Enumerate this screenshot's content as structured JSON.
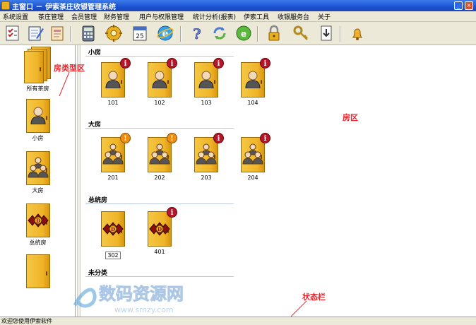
{
  "window": {
    "title": "主窗口 － 伊索茶庄收银管理系统"
  },
  "menu": [
    "系统设置",
    "茶庄管理",
    "会员管理",
    "财务管理",
    "用户与权限管理",
    "统计分析(报表)",
    "伊索工具",
    "收银服务台",
    "关于"
  ],
  "toolbar": [
    "checklist-icon",
    "notepad-icon",
    "notes-icon",
    "calculator-icon",
    "gear-icon",
    "calendar-icon",
    "browser-icon",
    "help-icon",
    "refresh-icon",
    "network-icon",
    "lock-icon",
    "key-icon",
    "export-icon",
    "bell-icon"
  ],
  "calendar_day": "25",
  "left_panel": {
    "room_types": [
      {
        "label": "所有茶房",
        "icon": "stacked-doors-icon"
      },
      {
        "label": "小房",
        "icon": "door-single-person-icon"
      },
      {
        "label": "大房",
        "icon": "door-group-icon"
      },
      {
        "label": "总统房",
        "icon": "door-royal-emblem-icon"
      },
      {
        "label": "",
        "icon": "door-blank-icon"
      }
    ]
  },
  "sections": [
    {
      "title": "小房",
      "rooms": [
        {
          "number": "101",
          "icon": "door-single-person-icon",
          "badge": "i"
        },
        {
          "number": "102",
          "icon": "door-single-person-icon",
          "badge": "i"
        },
        {
          "number": "103",
          "icon": "door-single-person-icon",
          "badge": "i"
        },
        {
          "number": "104",
          "icon": "door-single-person-icon",
          "badge": "i"
        }
      ]
    },
    {
      "title": "大房",
      "rooms": [
        {
          "number": "201",
          "icon": "door-group-icon",
          "badge": "!"
        },
        {
          "number": "202",
          "icon": "door-group-icon",
          "badge": "!"
        },
        {
          "number": "203",
          "icon": "door-group-icon",
          "badge": "i"
        },
        {
          "number": "204",
          "icon": "door-group-icon",
          "badge": "i"
        }
      ]
    },
    {
      "title": "总统房",
      "rooms": [
        {
          "number": "302",
          "icon": "door-royal-emblem-icon",
          "badge": "",
          "selected": true
        },
        {
          "number": "401",
          "icon": "door-royal-emblem-icon",
          "badge": "i"
        }
      ]
    },
    {
      "title": "未分类",
      "rooms": []
    }
  ],
  "annotations": {
    "room_type_area": "房类型区",
    "room_area": "房区",
    "status_bar": "状态栏"
  },
  "status": {
    "text": "欢迎您使用伊索软件"
  },
  "watermark": {
    "text_cn": "数码资源网",
    "text_url": "www.smzy.com"
  },
  "colors": {
    "door": "#f0b428",
    "badge_info": "#b7162a",
    "badge_warn": "#f08c10",
    "annotation": "#e8262c"
  }
}
